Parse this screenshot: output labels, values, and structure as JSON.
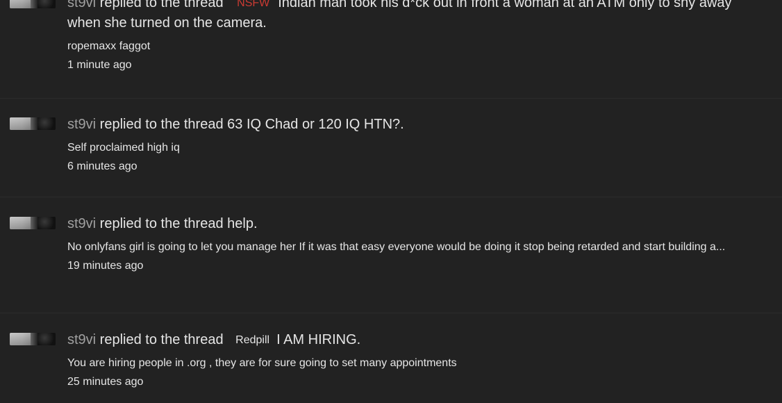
{
  "feed": {
    "items": [
      {
        "user": "st9vi",
        "action": " replied to the thread ",
        "prefix": "NSFW",
        "thread_title": "Indian man took his d*ck out in front a woman at an ATM only to shy away when she turned on the camera.",
        "snippet": "ropemaxx faggot",
        "time": "1 minute ago"
      },
      {
        "user": "st9vi",
        "action": " replied to the thread ",
        "prefix": "",
        "thread_title": "63 IQ Chad or 120 IQ HTN?.",
        "snippet": "Self proclaimed high iq",
        "time": "6 minutes ago"
      },
      {
        "user": "st9vi",
        "action": " replied to the thread ",
        "prefix": "",
        "thread_title": "help.",
        "snippet": "No onlyfans girl is going to let you manage her If it was that easy everyone would be doing it stop being retarded and start building a...",
        "time": "19 minutes ago"
      },
      {
        "user": "st9vi",
        "action": " replied to the thread ",
        "prefix": "Redpill",
        "thread_title": "I AM HIRING.",
        "snippet": "You are hiring people in .org , they are for sure going to set many appointments",
        "time": "25 minutes ago"
      }
    ]
  },
  "colors": {
    "background": "#222222",
    "text": "#e6e6e6",
    "username": "#a0a0a0",
    "nsfw_prefix": "#cc3b33"
  }
}
